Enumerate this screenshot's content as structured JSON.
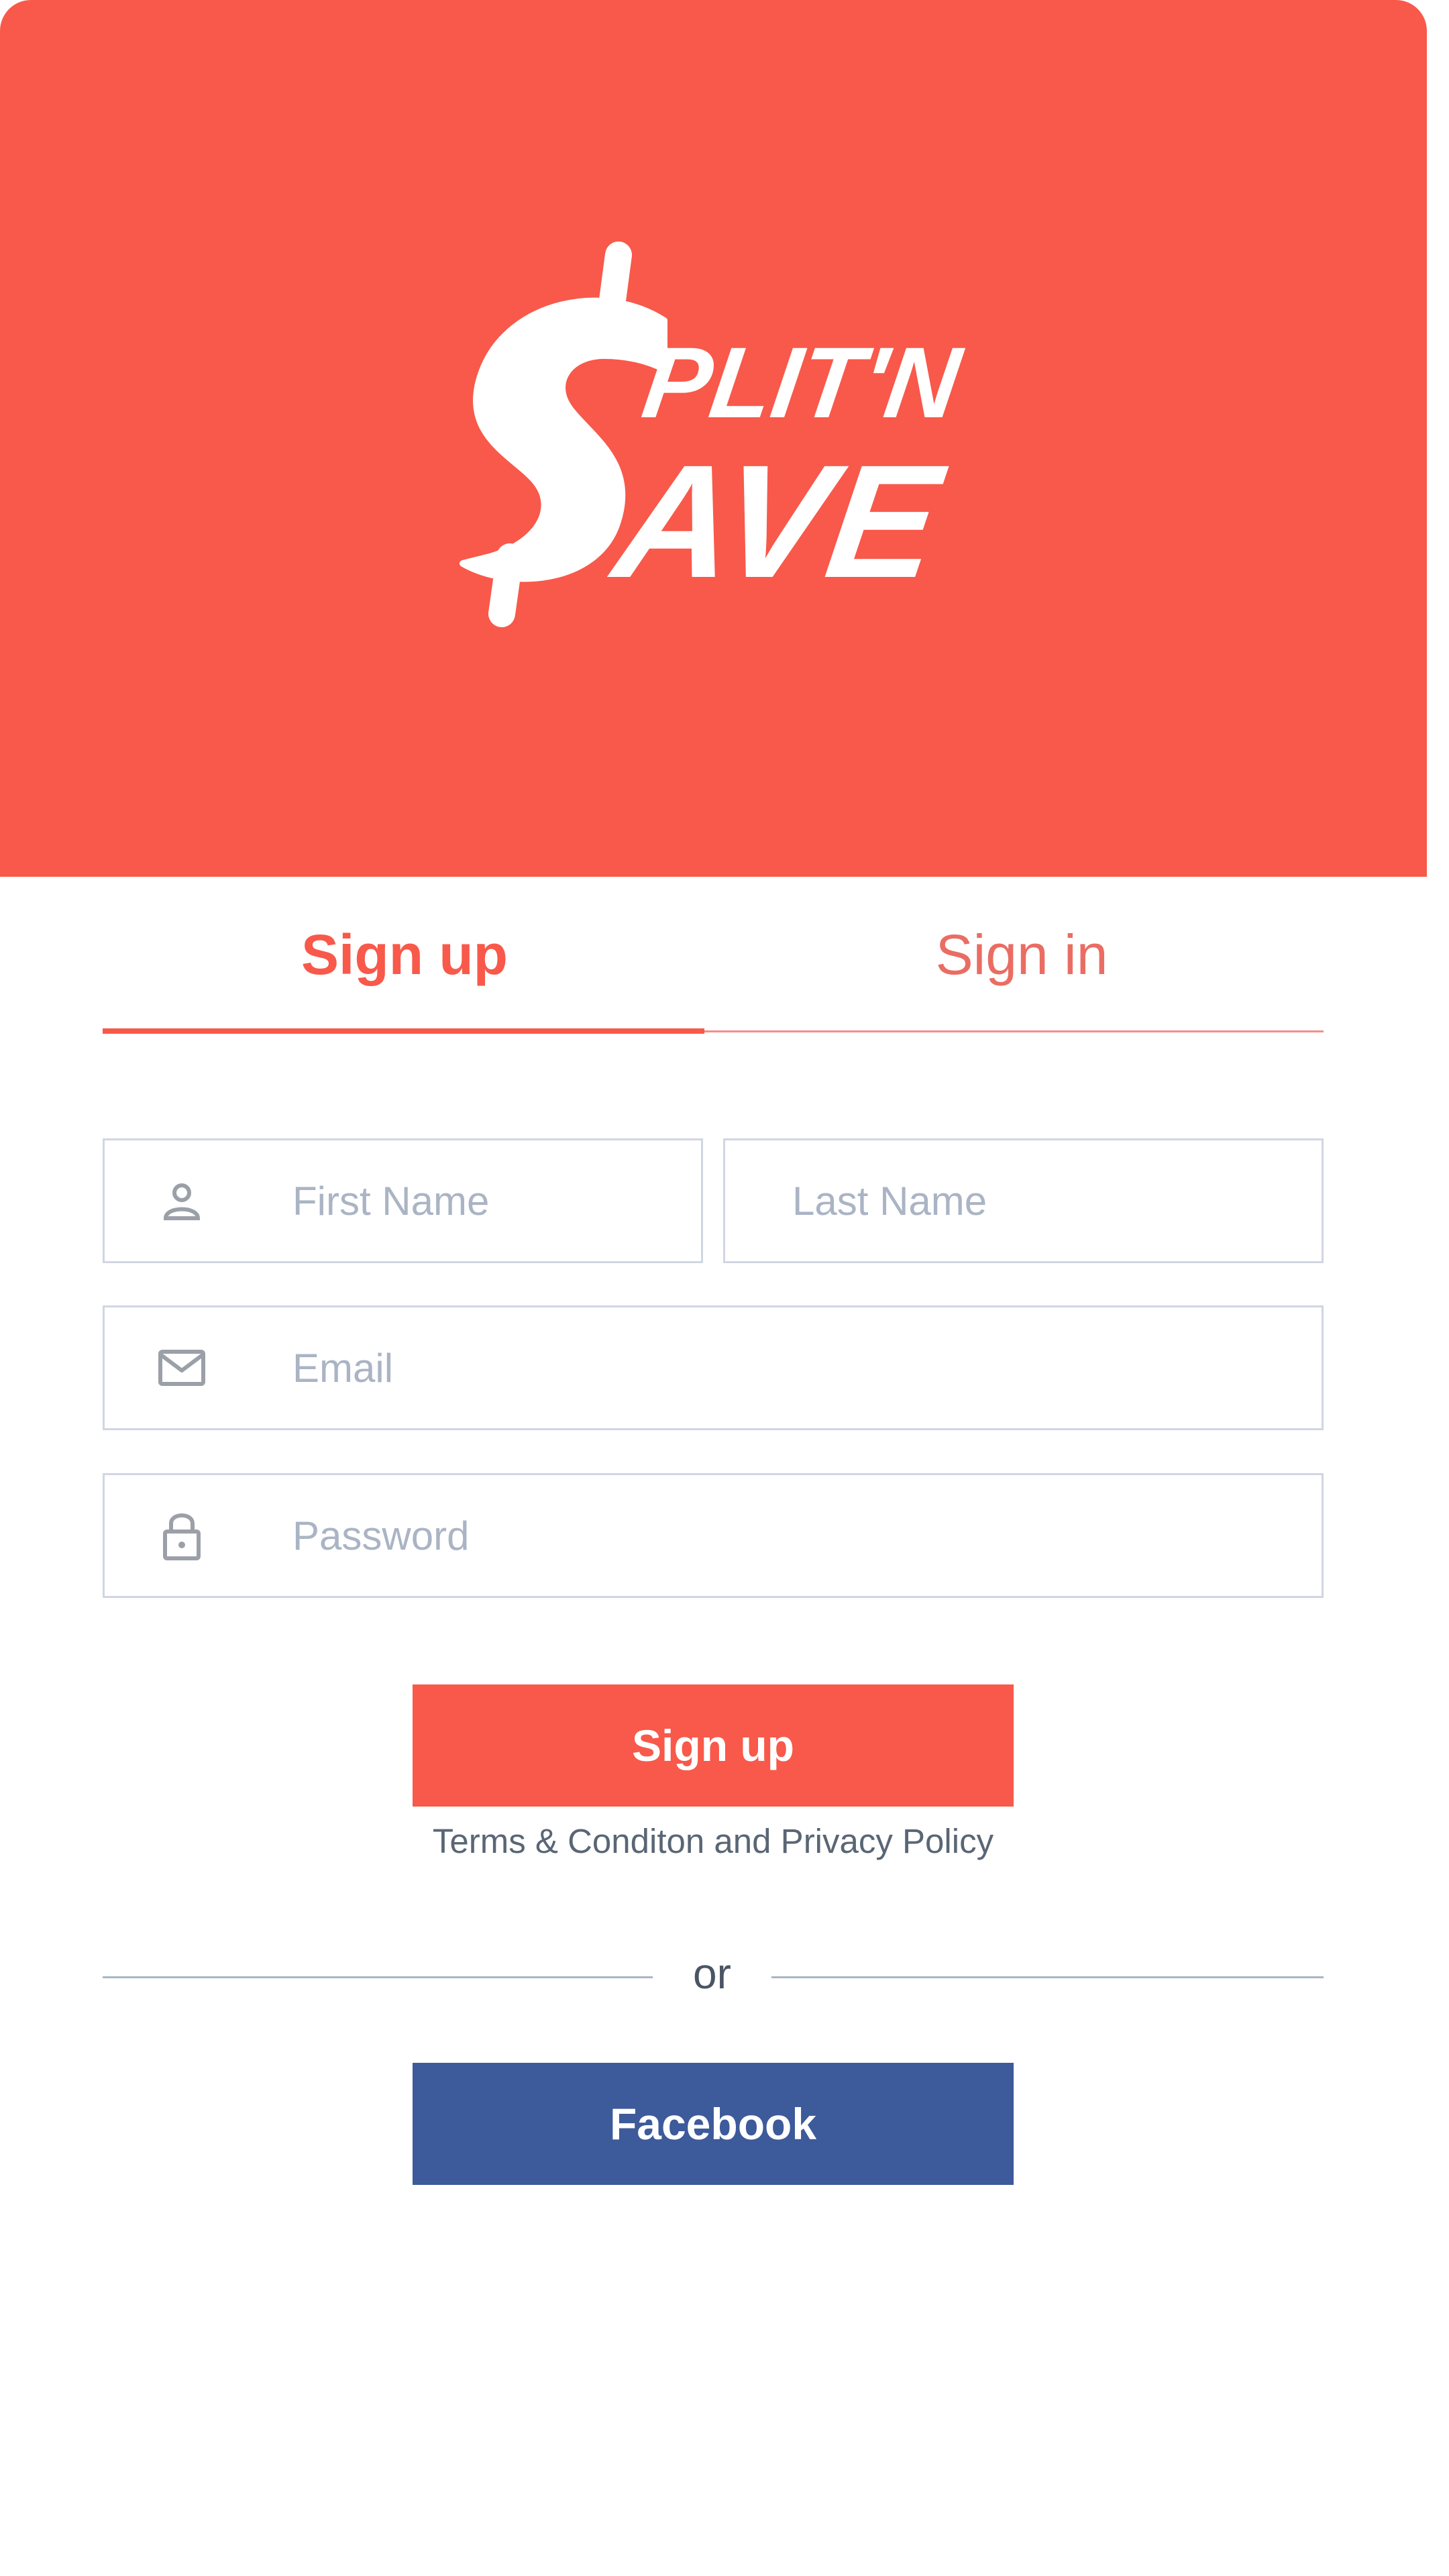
{
  "brand": {
    "logo_text": "Split'n Save",
    "header_color": "#f8594a"
  },
  "tabs": [
    {
      "label": "Sign up",
      "active": true
    },
    {
      "label": "Sign in",
      "active": false
    }
  ],
  "form": {
    "first_name": {
      "placeholder": "First Name",
      "value": "",
      "icon": "user-icon"
    },
    "last_name": {
      "placeholder": "Last Name",
      "value": ""
    },
    "email": {
      "placeholder": "Email",
      "value": "",
      "icon": "mail-icon"
    },
    "password": {
      "placeholder": "Password",
      "value": "",
      "icon": "lock-icon"
    }
  },
  "actions": {
    "signup_label": "Sign up",
    "terms_label": "Terms & Conditon and Privacy Policy",
    "or_label": "or",
    "facebook_label": "Facebook"
  },
  "colors": {
    "accent": "#f8594a",
    "facebook": "#3d5a9a",
    "field_border": "#d0d6e2",
    "placeholder": "#aab4c4"
  }
}
